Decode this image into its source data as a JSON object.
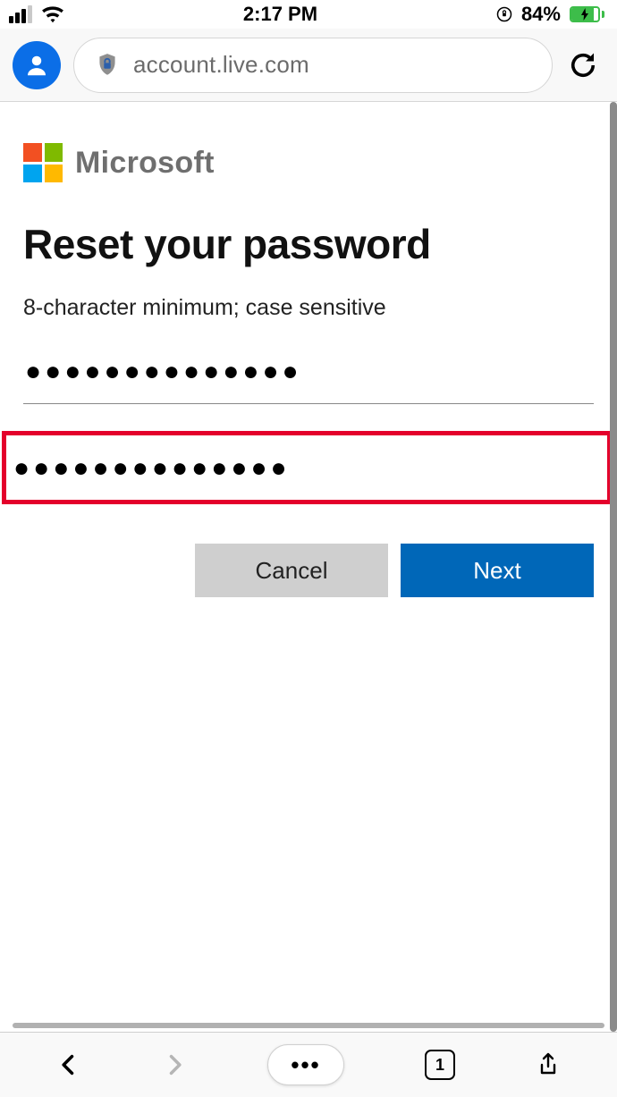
{
  "status": {
    "time": "2:17 PM",
    "battery_pct": "84%"
  },
  "browser": {
    "url_display": "account.live.com"
  },
  "ms": {
    "brand": "Microsoft"
  },
  "page": {
    "title": "Reset your password",
    "hint": "8-character minimum; case sensitive",
    "password_mask": "●●●●●●●●●●●●●●",
    "confirm_mask": "●●●●●●●●●●●●●●",
    "cancel": "Cancel",
    "next": "Next"
  },
  "toolbar": {
    "menu_dots": "•••",
    "tab_count": "1"
  }
}
